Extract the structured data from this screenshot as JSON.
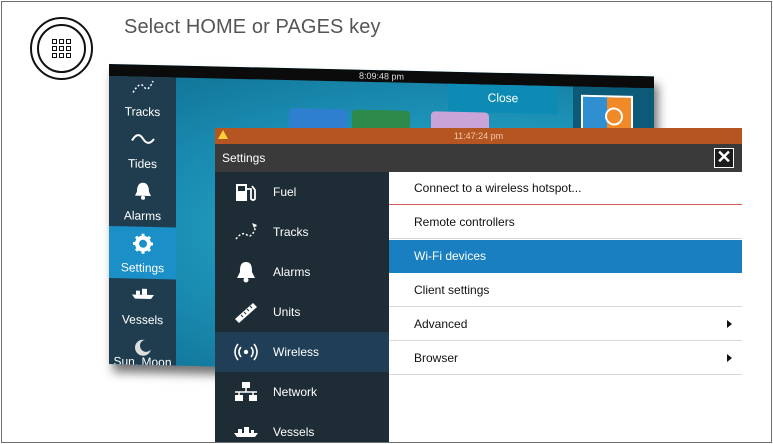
{
  "instruction": "Select HOME or PAGES key",
  "back_window": {
    "time": "8:09:48 pm",
    "close_label": "Close",
    "sidebar": [
      {
        "label": "Tracks",
        "icon": "tracks-icon"
      },
      {
        "label": "Tides",
        "icon": "tides-icon"
      },
      {
        "label": "Alarms",
        "icon": "bell-icon"
      },
      {
        "label": "Settings",
        "icon": "gear-icon",
        "active": true
      },
      {
        "label": "Vessels",
        "icon": "vessels-icon"
      },
      {
        "label": "Sun, Moon",
        "icon": "sun-moon-icon"
      }
    ]
  },
  "front_window": {
    "time": "11:47:24 pm",
    "title": "Settings",
    "close_symbol": "✕",
    "left_menu": [
      {
        "label": "Fuel",
        "icon": "fuel-icon"
      },
      {
        "label": "Tracks",
        "icon": "tracks-icon"
      },
      {
        "label": "Alarms",
        "icon": "bell-icon"
      },
      {
        "label": "Units",
        "icon": "ruler-icon"
      },
      {
        "label": "Wireless",
        "icon": "wireless-icon",
        "active": true
      },
      {
        "label": "Network",
        "icon": "network-icon"
      },
      {
        "label": "Vessels",
        "icon": "vessels-icon"
      }
    ],
    "right_menu": [
      {
        "label": "Connect to a wireless hotspot..."
      },
      {
        "label": "Remote controllers"
      },
      {
        "label": "Wi-Fi devices",
        "active": true
      },
      {
        "label": "Client settings"
      },
      {
        "label": "Advanced",
        "submenu": true
      },
      {
        "label": "Browser",
        "submenu": true
      }
    ]
  },
  "colors": {
    "status_bar": "#b45522",
    "active_sidebar": "#1a8fc8",
    "active_right": "#1a7fc0",
    "panel_dark": "#1e2c35"
  }
}
